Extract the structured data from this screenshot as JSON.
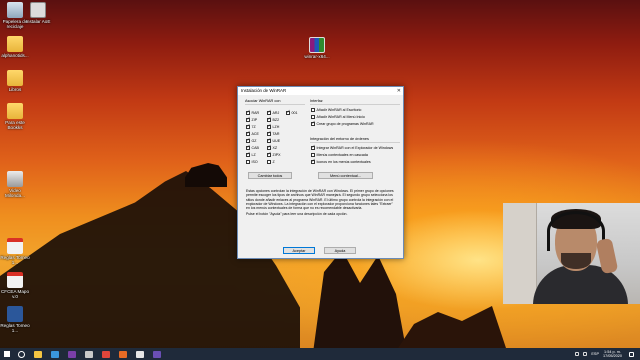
{
  "desktop": {
    "icons": [
      {
        "label": "Papelera de reciclaje",
        "icon": "recycle-bin-icon"
      },
      {
        "label": "Instalar AoE",
        "icon": "program-icon"
      },
      {
        "label": "alphanotids...",
        "icon": "folder-icon"
      },
      {
        "label": "Libros",
        "icon": "folder-icon"
      },
      {
        "label": "Para este Bookks",
        "icon": "folder-icon"
      },
      {
        "label": "Video Milonda...",
        "icon": "video-icon"
      },
      {
        "label": "Reglas Tomeo 1...",
        "icon": "pdf-icon"
      },
      {
        "label": "CFCEA Mapo v.0",
        "icon": "pdf-icon"
      },
      {
        "label": "Reglas Tomeo 1...",
        "icon": "word-icon"
      },
      {
        "label": "winrar-x64...",
        "icon": "winrar-icon"
      }
    ]
  },
  "dialog": {
    "title": "Instalación de WinRAR",
    "close_glyph": "✕",
    "assoc_title": "Asociar WinRAR con",
    "formats": [
      {
        "label": "RAR",
        "checked": true
      },
      {
        "label": "ARJ",
        "checked": true
      },
      {
        "label": "001",
        "checked": true
      },
      {
        "label": "ZIP",
        "checked": true
      },
      {
        "label": "BZ2",
        "checked": true
      },
      {
        "label": "7Z",
        "checked": true
      },
      {
        "label": "LZH",
        "checked": true
      },
      {
        "label": "ACE",
        "checked": true
      },
      {
        "label": "TAR",
        "checked": true
      },
      {
        "label": "GZ",
        "checked": true
      },
      {
        "label": "UUE",
        "checked": true
      },
      {
        "label": "CAB",
        "checked": true
      },
      {
        "label": "XZ",
        "checked": true
      },
      {
        "label": "LZ",
        "checked": true
      },
      {
        "label": "ZIPX",
        "checked": true
      },
      {
        "label": "ISO",
        "checked": false
      },
      {
        "label": "Z",
        "checked": false
      }
    ],
    "toggle_all_label": "Cambiar todos",
    "interface_title": "Interfaz",
    "interface_options": [
      {
        "label": "Añadir WinRAR al Escritorio",
        "checked": false
      },
      {
        "label": "Añadir WinRAR al Menú Inicio",
        "checked": false
      },
      {
        "label": "Crear grupo de programas WinRAR",
        "checked": true
      }
    ],
    "shell_title": "Integración del entorno de órdenes",
    "shell_options": [
      {
        "label": "Integrar WinRAR con el Explorador de Windows",
        "checked": true
      },
      {
        "label": "Menús contextuales en cascada",
        "checked": false
      },
      {
        "label": "Iconos en los menús contextuales",
        "checked": true
      }
    ],
    "context_menu_label": "Menú contextual...",
    "description_1": "Estas opciones controlan la integración de WinRAR con Windows. El primer grupo de opciones permite escoger los tipos de archivos que WinRAR manejará. El segundo grupo selecciona los sitios donde añadir enlaces al programa WinRAR. El último grupo controla la integración con el explorador de Windows. La integración con el explorador proporciona funciones tales \"Extraer\" en los menús contextuales de forma que no es recomendable desactivarla.",
    "description_2": "Pulse el botón \"Ayuda\" para leer una descripción de cada opción.",
    "ok_label": "Aceptar",
    "help_label": "Ayuda"
  },
  "taskbar": {
    "language": "ESP",
    "time": "1:54 p. m.",
    "date": "17/05/2020",
    "apps": [
      {
        "icon": "file-explorer-icon",
        "color": "#f4c542"
      },
      {
        "icon": "edge-icon",
        "color": "#3a96dd"
      },
      {
        "icon": "onenote-icon",
        "color": "#7b3fa8"
      },
      {
        "icon": "store-icon",
        "color": "#c9c9c9"
      },
      {
        "icon": "chrome-icon",
        "color": "#e0463b"
      },
      {
        "icon": "firefox-icon",
        "color": "#e86b25"
      },
      {
        "icon": "obs-icon",
        "color": "#e6e6e6"
      },
      {
        "icon": "winrar-icon",
        "color": "#6a4fb5"
      }
    ]
  }
}
